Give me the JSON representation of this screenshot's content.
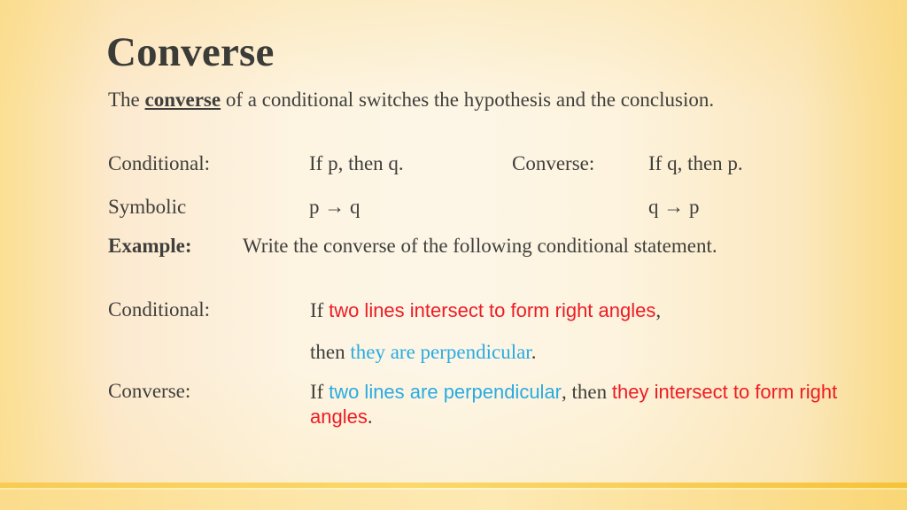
{
  "slide": {
    "title": "Converse",
    "background_left_color": "#fbdf93",
    "background_center_color": "#fdf6e7",
    "background_right_color": "#f9da85",
    "footer_bar_color": "#f8cb52",
    "text_color": "#3f3f3c",
    "accent_red": "#ed1c24",
    "accent_blue": "#29abe2"
  },
  "intro": {
    "before": "The ",
    "emphasis": "converse",
    "after": " of a conditional switches the hypothesis and the conclusion."
  },
  "abstract_row": {
    "label_left": "Conditional:",
    "value_left": "If p, then q.",
    "label_right": "Converse:",
    "value_right": "If q, then p."
  },
  "symbolic_row": {
    "label_left": "Symbolic",
    "value_left": "p → q",
    "value_right": "q → p"
  },
  "example": {
    "label": "Example:",
    "text": "Write the converse of the following conditional statement."
  },
  "statement_conditional": {
    "label": "Conditional:",
    "line1_prefix": "If ",
    "line1_hypothesis": "two lines intersect to form right angles",
    "line1_suffix": ",",
    "line2_prefix": "then ",
    "line2_conclusion": "they are perpendicular",
    "line2_suffix": "."
  },
  "statement_converse": {
    "label": "Converse:",
    "prefix": "If ",
    "hypothesis": "two lines are perpendicular",
    "middle": ", then ",
    "conclusion_part1": "they",
    "conclusion_part2": "intersect to form right angles",
    "suffix": "."
  }
}
